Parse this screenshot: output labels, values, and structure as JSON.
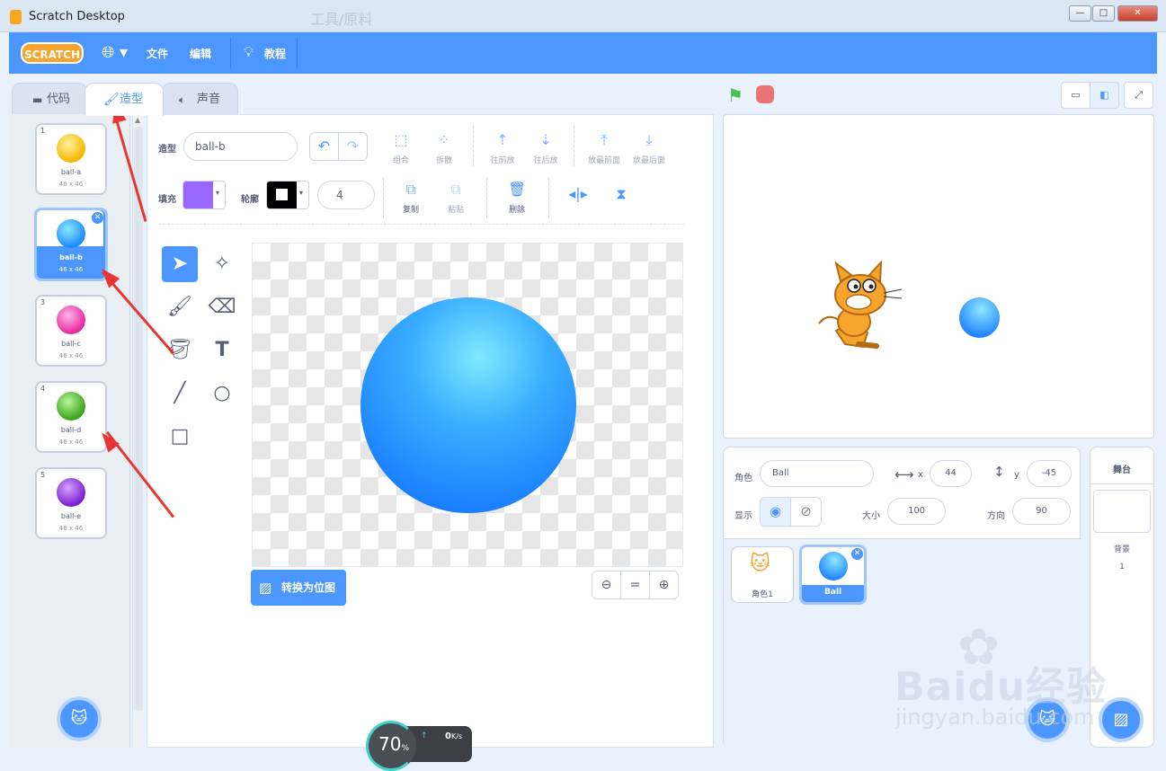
{
  "window": {
    "title": "Scratch Desktop",
    "buttons": [
      "—",
      "□",
      "✕"
    ],
    "faded_title": "工具/原料"
  },
  "menubar": {
    "logo": "SCRATCH",
    "file": "文件",
    "edit": "编辑",
    "tutorials": "教程"
  },
  "tabs": {
    "code": "代码",
    "costumes": "造型",
    "sounds": "声音"
  },
  "costumes": [
    {
      "num": "1",
      "name": "ball-a",
      "size": "46 x 46",
      "color": "#f7b500"
    },
    {
      "num": "2",
      "name": "ball-b",
      "size": "46 x 46",
      "color": "#1a8cff"
    },
    {
      "num": "3",
      "name": "ball-c",
      "size": "46 x 46",
      "color": "#e62aa0"
    },
    {
      "num": "4",
      "name": "ball-d",
      "size": "46 x 46",
      "color": "#3aa51c"
    },
    {
      "num": "5",
      "name": "ball-e",
      "size": "46 x 46",
      "color": "#7a1fd0"
    }
  ],
  "editor": {
    "costume_label": "造型",
    "costume_name": "ball-b",
    "group": "组合",
    "ungroup": "拆散",
    "forward": "往前放",
    "backward": "往后放",
    "front": "放最前面",
    "back": "放最后面",
    "fill_label": "填充",
    "fill_color": "#9966ff",
    "outline_label": "轮廓",
    "outline_width": "4",
    "copy": "复制",
    "paste": "粘贴",
    "delete": "删除",
    "convert": "转换为位图",
    "zoom_reset": "="
  },
  "sprite_info": {
    "sprite_label": "角色",
    "sprite_name": "Ball",
    "x_label": "x",
    "x": "44",
    "y_label": "y",
    "y": "-45",
    "show_label": "显示",
    "size_label": "大小",
    "size": "100",
    "direction_label": "方向",
    "direction": "90"
  },
  "sprites": [
    {
      "name": "角色1"
    },
    {
      "name": "Ball"
    }
  ],
  "stage_panel": {
    "title": "舞台",
    "backdrops_label": "背景",
    "backdrops_count": "1"
  },
  "overlay": {
    "percent": "70",
    "percent_unit": "%",
    "speed": "0",
    "speed_unit": "K/s",
    "watermark": "Baidu经验",
    "watermark_url": "jingyan.baidu.com"
  }
}
